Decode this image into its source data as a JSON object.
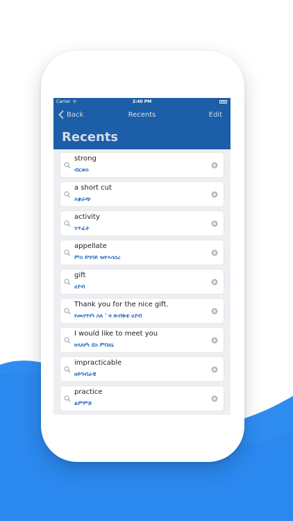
{
  "colors": {
    "header": "#1c5ea7",
    "wave": "#2f8cf0",
    "amharic_text": "#2a6cc2"
  },
  "status_bar": {
    "carrier": "Carrier",
    "time": "2:40 PM"
  },
  "navbar": {
    "back_label": "Back",
    "title": "Recents",
    "edit_label": "Edit",
    "large_title": "Recents"
  },
  "recents": [
    {
      "english": "strong",
      "amharic": "ብርቱስ"
    },
    {
      "english": "a short cut",
      "amharic": "አቋራጭ"
    },
    {
      "english": "activity",
      "amharic": "ንጥፈት"
    },
    {
      "english": "appellate",
      "amharic": "ምስ ይግባይ ዝተኣሳሰረ"
    },
    {
      "english": "gift",
      "amharic": "ሀያብ"
    },
    {
      "english": "Thank you for the nice gift.",
      "amharic": "የመሰግንካ ስለ ' ዛ ጽብቅቲ ሀያብ"
    },
    {
      "english": "I would like to meet you",
      "amharic": "ክላለየካ ደስ ምበለኒ"
    },
    {
      "english": "impracticable",
      "amharic": "ዘይግብራዊ"
    },
    {
      "english": "practice",
      "amharic": "ልምምድ"
    }
  ]
}
